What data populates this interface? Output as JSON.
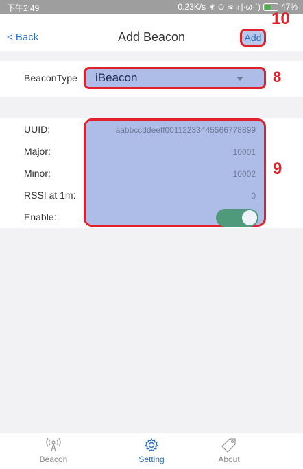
{
  "status_bar": {
    "time": "下午2:49",
    "net_speed": "0.23K/s",
    "status_glyphs": "∗ ⊙ ≋ ᵢₗ |·ω·`)",
    "battery": "47%"
  },
  "navbar": {
    "back_label": "< Back",
    "title": "Add Beacon",
    "add_label": "Add"
  },
  "annotations": {
    "add": "10",
    "type": "8",
    "fields": "9"
  },
  "beacon_type": {
    "label": "BeaconType",
    "value": "iBeacon"
  },
  "fields": [
    {
      "label": "UUID:",
      "value": "aabbccddeeff00112233445566778899"
    },
    {
      "label": "Major:",
      "value": "10001"
    },
    {
      "label": "Minor:",
      "value": "10002"
    },
    {
      "label": "RSSI at 1m:",
      "value": "0"
    },
    {
      "label": "Enable:",
      "value": ""
    }
  ],
  "enable_on": true,
  "tabs": [
    {
      "label": "Beacon",
      "icon": "antenna-icon",
      "active": false
    },
    {
      "label": "Setting",
      "icon": "gear-icon",
      "active": true
    },
    {
      "label": "About",
      "icon": "tag-icon",
      "active": false
    }
  ],
  "colors": {
    "accent": "#2f6fbf",
    "annotation_red": "#e0202a",
    "highlight": "#aebde8",
    "toggle_on": "#4f9a7b"
  }
}
